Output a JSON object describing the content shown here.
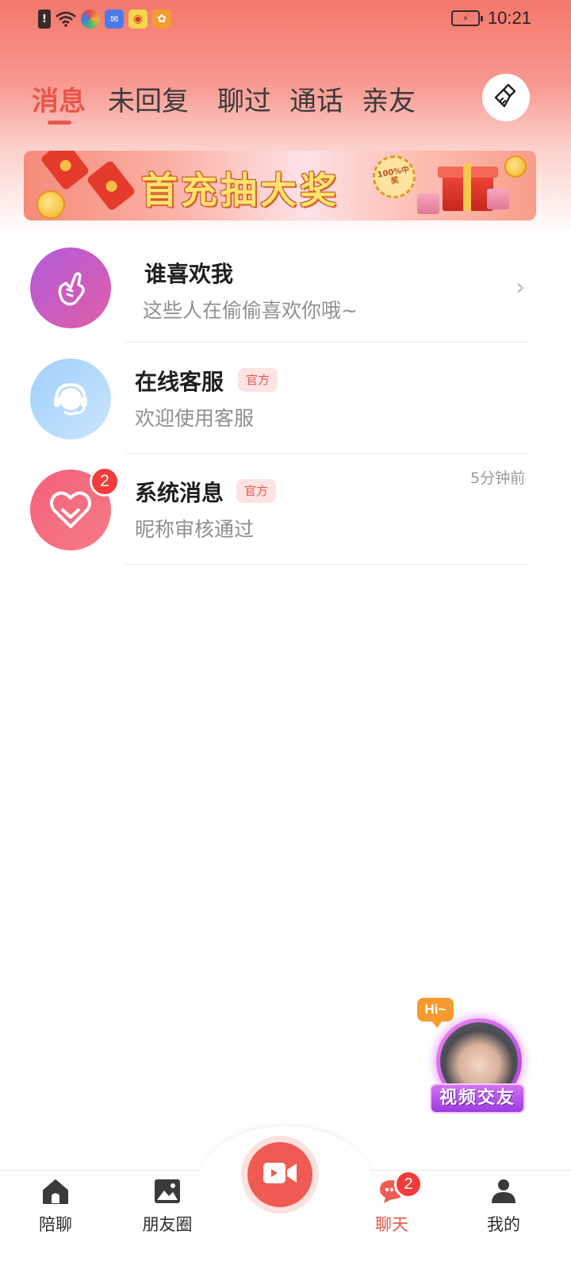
{
  "status_bar": {
    "time": "10:21",
    "icons": [
      "alert-icon",
      "wifi-icon",
      "app-icon",
      "app-icon",
      "weibo-icon",
      "uc-icon",
      "battery-icon"
    ]
  },
  "tabs": [
    {
      "label": "消息",
      "active": true
    },
    {
      "label": "未回复",
      "active": false
    },
    {
      "label": "聊过",
      "active": false
    },
    {
      "label": "通话",
      "active": false
    },
    {
      "label": "亲友",
      "active": false
    }
  ],
  "banner": {
    "title": "首充抽大奖",
    "seal_text": "100%中奖"
  },
  "list": [
    {
      "title": "谁喜欢我",
      "subtitle": "这些人在偷偷喜欢你哦~",
      "icon": "finger-heart-icon"
    },
    {
      "title": "在线客服",
      "badge": "官方",
      "subtitle": "欢迎使用客服",
      "icon": "headset-icon"
    },
    {
      "title": "系统消息",
      "badge": "官方",
      "subtitle": "昵称审核通过",
      "time": "5分钟前",
      "unread": "2",
      "icon": "heart-icon"
    }
  ],
  "promo": {
    "hi": "Hi~",
    "label": "视频交友"
  },
  "bottom_nav": [
    {
      "label": "陪聊",
      "icon": "home-icon",
      "active": false
    },
    {
      "label": "朋友圈",
      "icon": "picture-icon",
      "active": false
    },
    {
      "label": "",
      "icon": "video-camera-icon",
      "active": false
    },
    {
      "label": "聊天",
      "icon": "chat-icon",
      "active": true,
      "badge": "2"
    },
    {
      "label": "我的",
      "icon": "person-icon",
      "active": false
    }
  ],
  "colors": {
    "accent": "#e8564a",
    "badge_red": "#f33b3b",
    "official_bg": "#fde3e2"
  }
}
